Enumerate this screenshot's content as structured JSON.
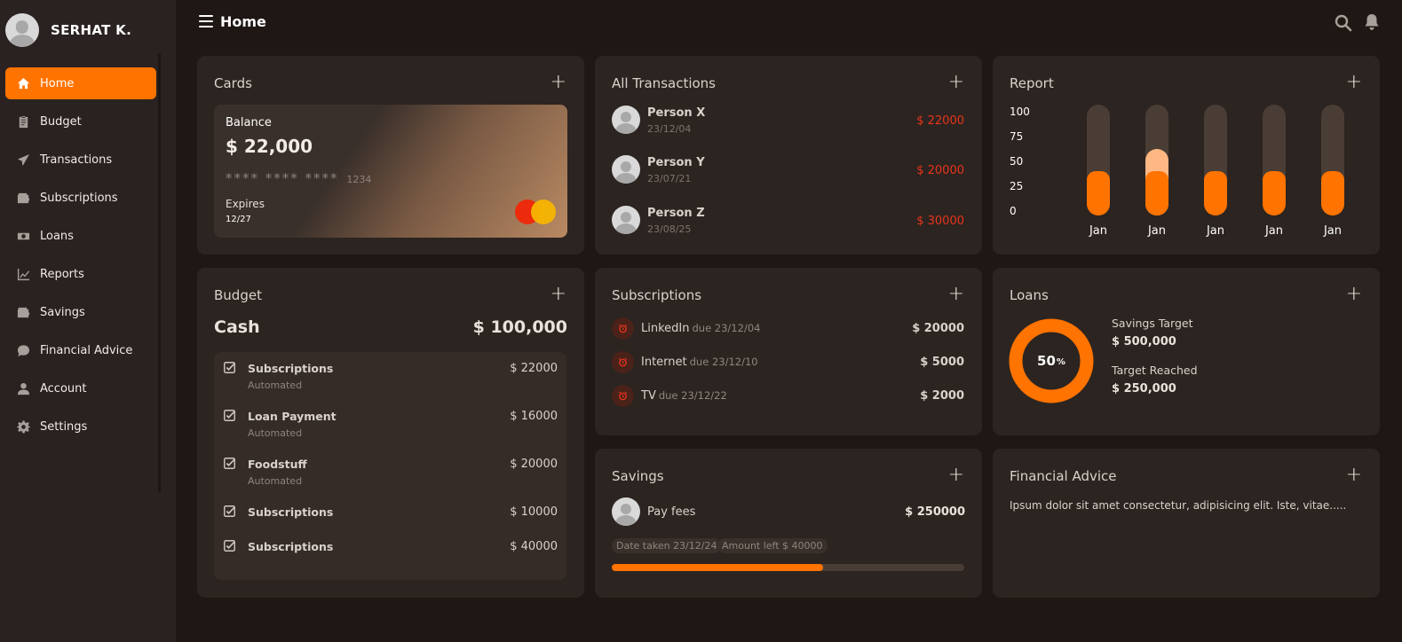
{
  "user": {
    "name": "SERHAT K."
  },
  "nav": {
    "items": [
      {
        "label": "Home",
        "icon": "home-icon",
        "active": true
      },
      {
        "label": "Budget",
        "icon": "clipboard-icon"
      },
      {
        "label": "Transactions",
        "icon": "send-icon"
      },
      {
        "label": "Subscriptions",
        "icon": "wallet-icon"
      },
      {
        "label": "Loans",
        "icon": "money-icon"
      },
      {
        "label": "Reports",
        "icon": "chart-line-icon"
      },
      {
        "label": "Savings",
        "icon": "wallet-icon"
      },
      {
        "label": "Financial Advice",
        "icon": "comment-dollar-icon"
      },
      {
        "label": "Account",
        "icon": "user-icon"
      },
      {
        "label": "Settings",
        "icon": "gear-icon"
      }
    ]
  },
  "topbar": {
    "title": "Home"
  },
  "colors": {
    "accent": "#ff7300",
    "negative": "#e8341c",
    "background": "#1e1714",
    "panel": "#2c2420"
  },
  "cards": {
    "title": "Cards",
    "balance_label": "Balance",
    "balance": "$ 22,000",
    "number_masked": "**** **** ****",
    "number_last": "1234",
    "expires_label": "Expires",
    "expires": "12/27"
  },
  "transactions": {
    "title": "All Transactions",
    "items": [
      {
        "name": "Person X",
        "date": "23/12/04",
        "amount": "$ 22000"
      },
      {
        "name": "Person Y",
        "date": "23/07/21",
        "amount": "$ 20000"
      },
      {
        "name": "Person Z",
        "date": "23/08/25",
        "amount": "$ 30000"
      }
    ]
  },
  "report": {
    "title": "Report",
    "y_ticks": [
      "100",
      "75",
      "50",
      "25",
      "0"
    ]
  },
  "chart_data": {
    "type": "bar",
    "categories": [
      "Jan",
      "Jan",
      "Jan",
      "Jan",
      "Jan"
    ],
    "series": [
      {
        "values": [
          40,
          40,
          40,
          40,
          40
        ]
      },
      {
        "values": [
          0,
          60,
          0,
          0,
          0
        ]
      }
    ],
    "ylim": [
      0,
      100
    ]
  },
  "budget": {
    "title": "Budget",
    "cash_label": "Cash",
    "cash_value": "$ 100,000",
    "items": [
      {
        "name": "Subscriptions",
        "sub": "Automated",
        "amount": "$ 22000"
      },
      {
        "name": "Loan Payment",
        "sub": "Automated",
        "amount": "$ 16000"
      },
      {
        "name": "Foodstuff",
        "sub": "Automated",
        "amount": "$ 20000"
      },
      {
        "name": "Subscriptions",
        "sub": "",
        "amount": "$ 10000"
      },
      {
        "name": "Subscriptions",
        "sub": "",
        "amount": "$ 40000"
      }
    ]
  },
  "subscriptions": {
    "title": "Subscriptions",
    "items": [
      {
        "name": "LinkedIn",
        "due": "due 23/12/04",
        "amount": "$ 20000"
      },
      {
        "name": "Internet",
        "due": "due 23/12/10",
        "amount": "$ 5000"
      },
      {
        "name": "TV",
        "due": "due 23/12/22",
        "amount": "$ 2000"
      }
    ]
  },
  "loans": {
    "title": "Loans",
    "percent": "50",
    "percent_sign": "%",
    "progress": 0.5,
    "savings_target_label": "Savings Target",
    "savings_target": "$ 500,000",
    "target_reached_label": "Target Reached",
    "target_reached": "$ 250,000"
  },
  "savings": {
    "title": "Savings",
    "name": "Pay fees",
    "amount": "$ 250000",
    "date_taken": "Date taken 23/12/24",
    "amount_left": "Amount left $ 40000",
    "progress": 0.6
  },
  "advice": {
    "title": "Financial Advice",
    "text": "Ipsum dolor sit amet consectetur, adipisicing elit. Iste, vitae....."
  }
}
